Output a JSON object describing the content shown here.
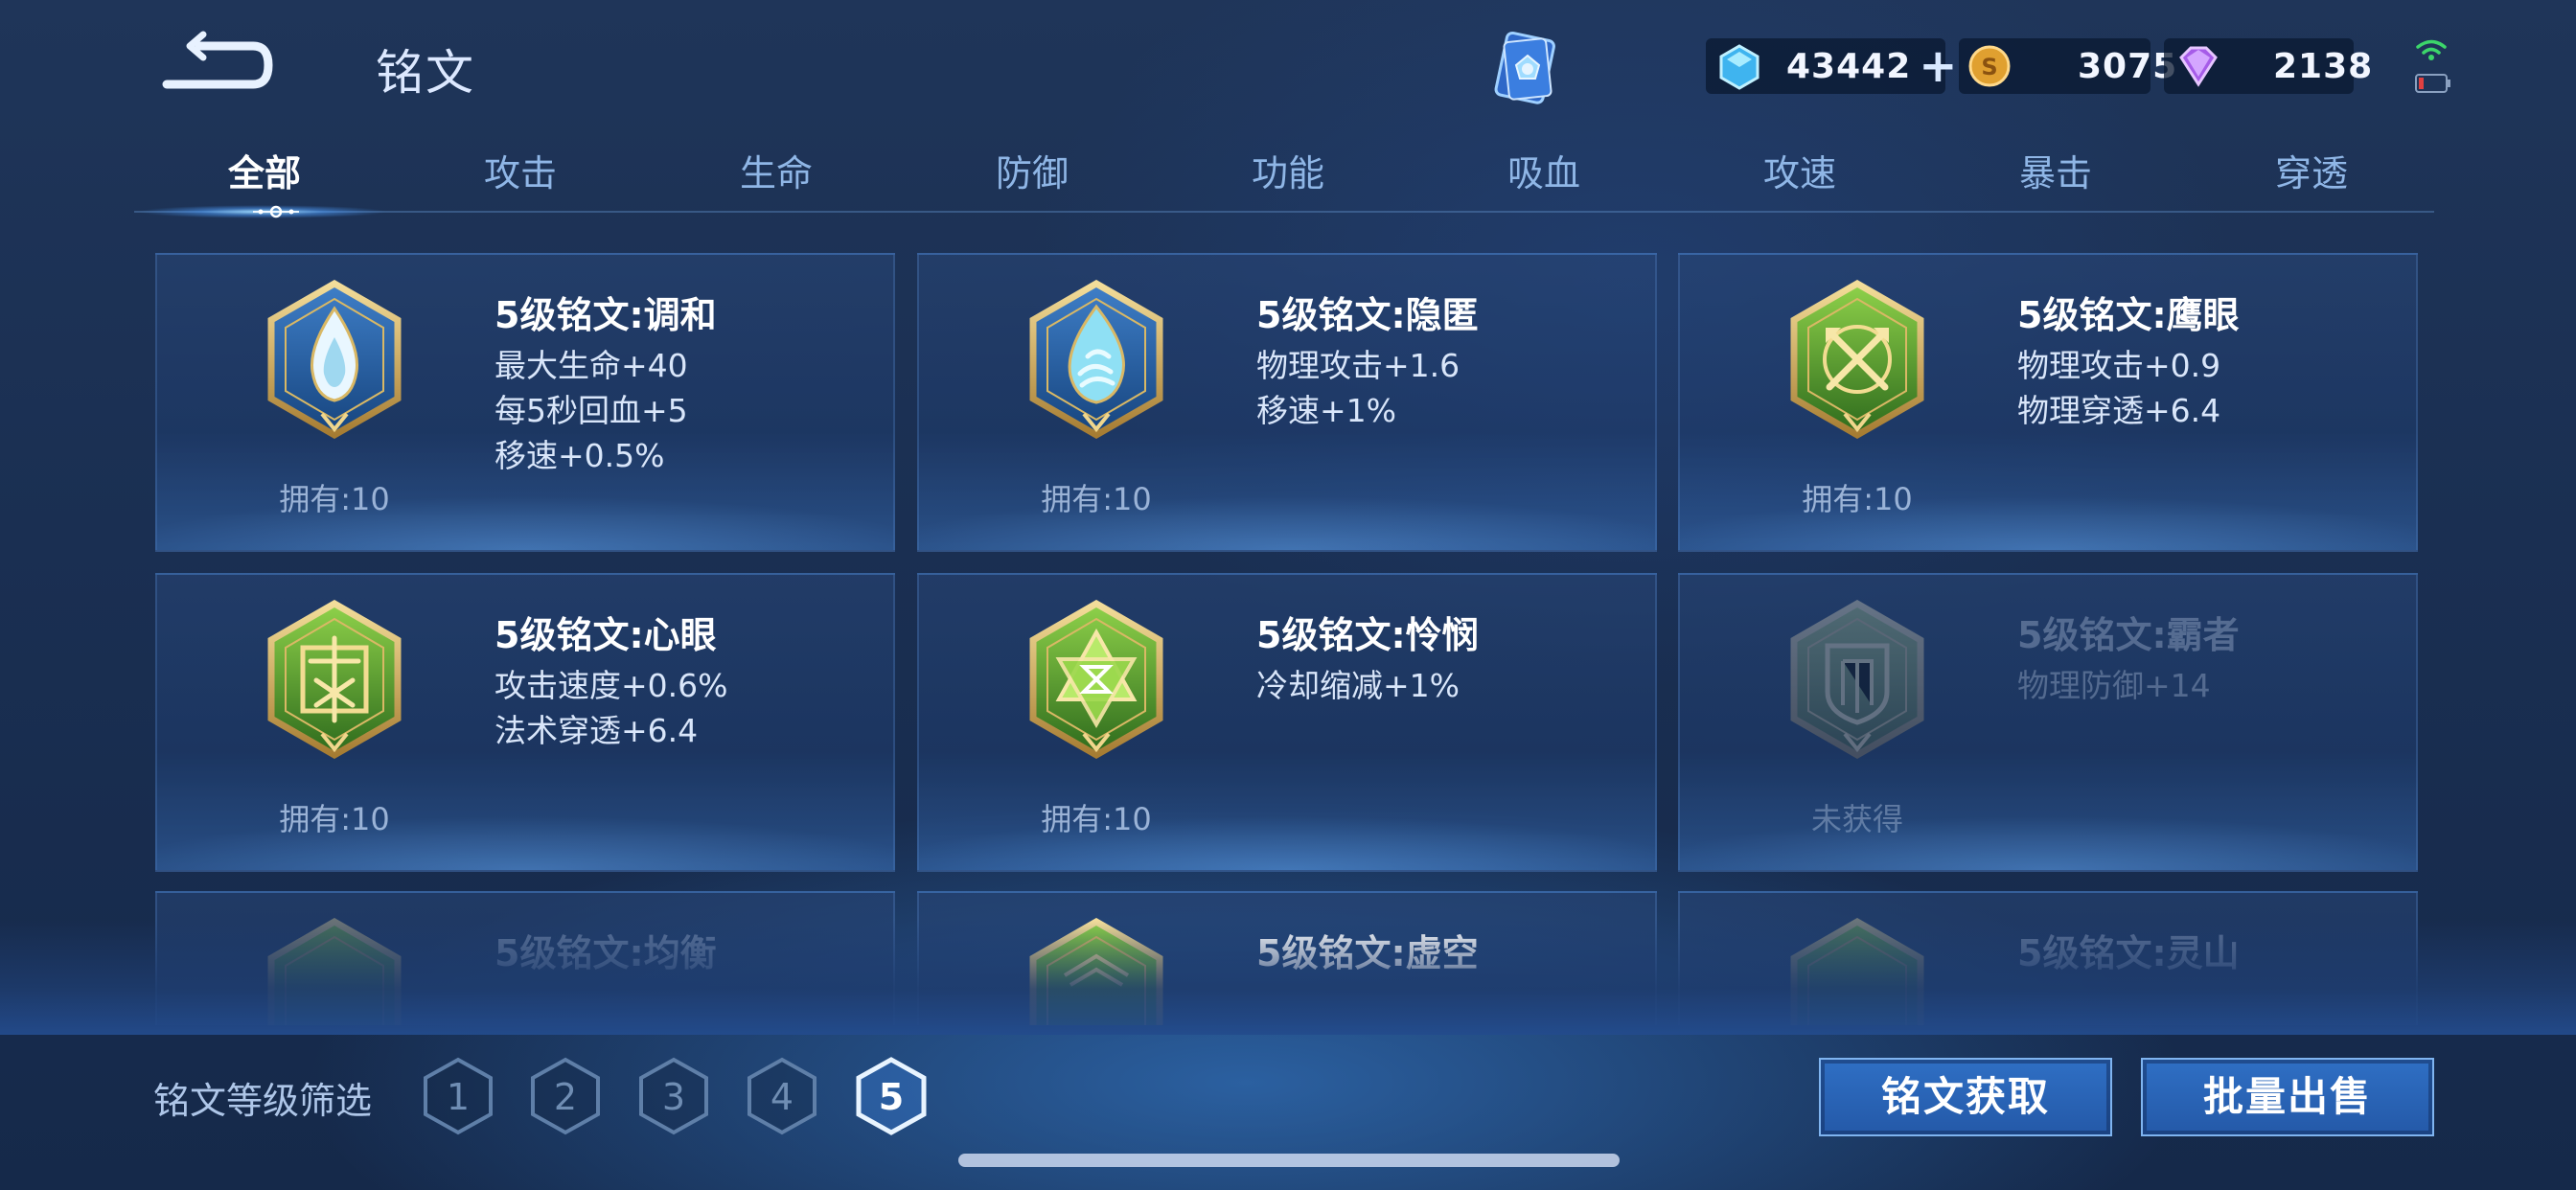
{
  "header": {
    "title": "铭文",
    "currencies": [
      {
        "icon": "crystal-icon",
        "value": "43442",
        "color": "#5cc8ff"
      },
      {
        "icon": "gold-coin-icon",
        "value": "3075",
        "color": "#e6a43a"
      },
      {
        "icon": "gem-icon",
        "value": "2138",
        "color": "#b46cf0"
      }
    ]
  },
  "tabs": [
    {
      "label": "全部",
      "active": true
    },
    {
      "label": "攻击",
      "active": false
    },
    {
      "label": "生命",
      "active": false
    },
    {
      "label": "防御",
      "active": false
    },
    {
      "label": "功能",
      "active": false
    },
    {
      "label": "吸血",
      "active": false
    },
    {
      "label": "攻速",
      "active": false
    },
    {
      "label": "暴击",
      "active": false
    },
    {
      "label": "穿透",
      "active": false
    }
  ],
  "runes": [
    {
      "name": "5级铭文:调和",
      "attrs": [
        "最大生命+40",
        "每5秒回血+5",
        "移速+0.5%"
      ],
      "owned": "拥有:10",
      "color": "blue",
      "icon": "droplet-rune-icon"
    },
    {
      "name": "5级铭文:隐匿",
      "attrs": [
        "物理攻击+1.6",
        "移速+1%"
      ],
      "owned": "拥有:10",
      "color": "blue",
      "icon": "flame-rune-icon"
    },
    {
      "name": "5级铭文:鹰眼",
      "attrs": [
        "物理攻击+0.9",
        "物理穿透+6.4"
      ],
      "owned": "拥有:10",
      "color": "green",
      "icon": "crossed-arrows-rune-icon"
    },
    {
      "name": "5级铭文:心眼",
      "attrs": [
        "攻击速度+0.6%",
        "法术穿透+6.4"
      ],
      "owned": "拥有:10",
      "color": "green",
      "icon": "gate-rune-icon"
    },
    {
      "name": "5级铭文:怜悯",
      "attrs": [
        "冷却缩减+1%"
      ],
      "owned": "拥有:10",
      "color": "green",
      "icon": "hourglass-star-rune-icon"
    },
    {
      "name": "5级铭文:霸者",
      "attrs": [
        "物理防御+14"
      ],
      "owned": "未获得",
      "color": "green",
      "icon": "shield-rune-icon",
      "locked": true
    },
    {
      "name": "5级铭文:均衡",
      "attrs": [],
      "owned": "",
      "color": "green",
      "icon": "rune-icon"
    },
    {
      "name": "5级铭文:虚空",
      "attrs": [],
      "owned": "",
      "color": "green",
      "icon": "rune-icon"
    },
    {
      "name": "5级铭文:灵山",
      "attrs": [],
      "owned": "",
      "color": "green",
      "icon": "rune-icon"
    }
  ],
  "footer": {
    "filter_label": "铭文等级筛选",
    "levels": [
      "1",
      "2",
      "3",
      "4",
      "5"
    ],
    "selected_level": "5",
    "acquire_button": "铭文获取",
    "sell_button": "批量出售"
  }
}
